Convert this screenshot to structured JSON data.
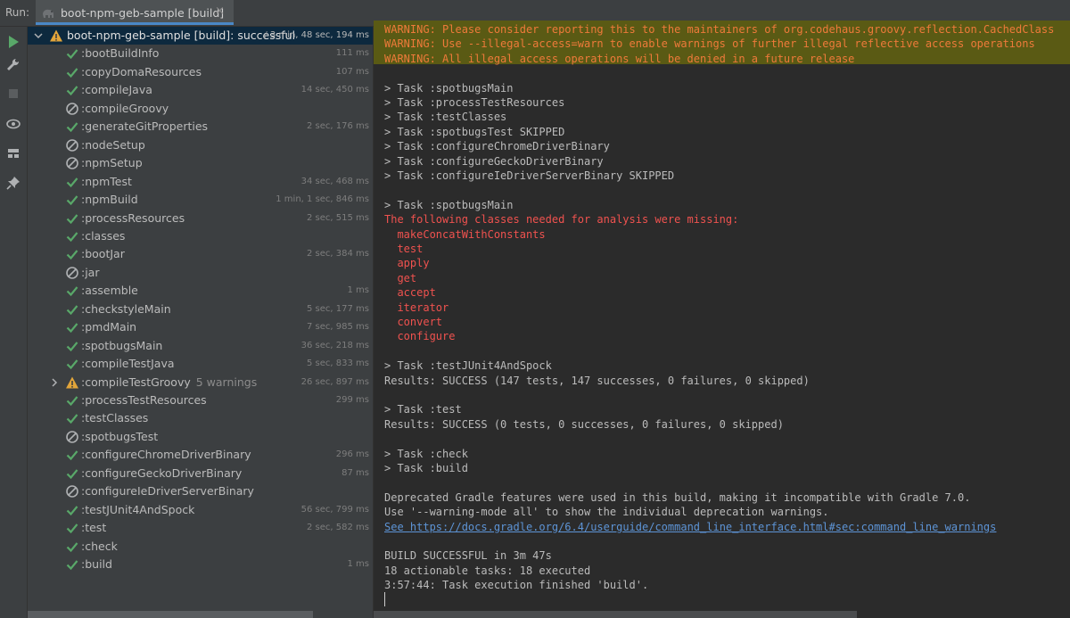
{
  "window": {
    "run_label": "Run:"
  },
  "tab": {
    "title": "boot-npm-geb-sample [build]",
    "close_glyph": "×"
  },
  "colors": {
    "success": "#59a869",
    "warning": "#e2a53a",
    "skipped": "#afb1b3",
    "accent": "#4a88c7"
  },
  "tree": {
    "root": {
      "name": "boot-npm-geb-sample [build]:",
      "status_text": "successful",
      "time": "3 min, 48 sec, 194 ms"
    },
    "tasks": [
      {
        "name": ":bootBuildInfo",
        "status": "success",
        "time": "111 ms"
      },
      {
        "name": ":copyDomaResources",
        "status": "success",
        "time": "107 ms"
      },
      {
        "name": ":compileJava",
        "status": "success",
        "time": "14 sec, 450 ms"
      },
      {
        "name": ":compileGroovy",
        "status": "skipped",
        "time": ""
      },
      {
        "name": ":generateGitProperties",
        "status": "success",
        "time": "2 sec, 176 ms"
      },
      {
        "name": ":nodeSetup",
        "status": "skipped",
        "time": ""
      },
      {
        "name": ":npmSetup",
        "status": "skipped",
        "time": ""
      },
      {
        "name": ":npmTest",
        "status": "success",
        "time": "34 sec, 468 ms"
      },
      {
        "name": ":npmBuild",
        "status": "success",
        "time": "1 min, 1 sec, 846 ms"
      },
      {
        "name": ":processResources",
        "status": "success",
        "time": "2 sec, 515 ms"
      },
      {
        "name": ":classes",
        "status": "success",
        "time": ""
      },
      {
        "name": ":bootJar",
        "status": "success",
        "time": "2 sec, 384 ms"
      },
      {
        "name": ":jar",
        "status": "skipped",
        "time": ""
      },
      {
        "name": ":assemble",
        "status": "success",
        "time": "1 ms"
      },
      {
        "name": ":checkstyleMain",
        "status": "success",
        "time": "5 sec, 177 ms"
      },
      {
        "name": ":pmdMain",
        "status": "success",
        "time": "7 sec, 985 ms"
      },
      {
        "name": ":spotbugsMain",
        "status": "success",
        "time": "36 sec, 218 ms"
      },
      {
        "name": ":compileTestJava",
        "status": "success",
        "time": "5 sec, 833 ms"
      },
      {
        "name": ":compileTestGroovy",
        "status": "warning",
        "warnings": "5 warnings",
        "time": "26 sec, 897 ms",
        "expandable": true
      },
      {
        "name": ":processTestResources",
        "status": "success",
        "time": "299 ms"
      },
      {
        "name": ":testClasses",
        "status": "success",
        "time": ""
      },
      {
        "name": ":spotbugsTest",
        "status": "skipped",
        "time": ""
      },
      {
        "name": ":configureChromeDriverBinary",
        "status": "success",
        "time": "296 ms"
      },
      {
        "name": ":configureGeckoDriverBinary",
        "status": "success",
        "time": "87 ms"
      },
      {
        "name": ":configureIeDriverServerBinary",
        "status": "skipped",
        "time": ""
      },
      {
        "name": ":testJUnit4AndSpock",
        "status": "success",
        "time": "56 sec, 799 ms"
      },
      {
        "name": ":test",
        "status": "success",
        "time": "2 sec, 582 ms"
      },
      {
        "name": ":check",
        "status": "success",
        "time": ""
      },
      {
        "name": ":build",
        "status": "success",
        "time": "1 ms"
      }
    ]
  },
  "console": {
    "lines": [
      {
        "type": "warn",
        "text": "WARNING: Please consider reporting this to the maintainers of org.codehaus.groovy.reflection.CachedClass"
      },
      {
        "type": "warn",
        "text": "WARNING: Use --illegal-access=warn to enable warnings of further illegal reflective access operations"
      },
      {
        "type": "warn",
        "text": "WARNING: All illegal access operations will be denied in a future release"
      },
      {
        "type": "blank",
        "text": ""
      },
      {
        "type": "task",
        "text": "> Task :spotbugsMain"
      },
      {
        "type": "task",
        "text": "> Task :processTestResources"
      },
      {
        "type": "task",
        "text": "> Task :testClasses"
      },
      {
        "type": "task",
        "text": "> Task :spotbugsTest SKIPPED"
      },
      {
        "type": "task",
        "text": "> Task :configureChromeDriverBinary"
      },
      {
        "type": "task",
        "text": "> Task :configureGeckoDriverBinary"
      },
      {
        "type": "task",
        "text": "> Task :configureIeDriverServerBinary SKIPPED"
      },
      {
        "type": "blank",
        "text": ""
      },
      {
        "type": "task",
        "text": "> Task :spotbugsMain"
      },
      {
        "type": "err",
        "text": "The following classes needed for analysis were missing:"
      },
      {
        "type": "err",
        "text": "  makeConcatWithConstants"
      },
      {
        "type": "err",
        "text": "  test"
      },
      {
        "type": "err",
        "text": "  apply"
      },
      {
        "type": "err",
        "text": "  get"
      },
      {
        "type": "err",
        "text": "  accept"
      },
      {
        "type": "err",
        "text": "  iterator"
      },
      {
        "type": "err",
        "text": "  convert"
      },
      {
        "type": "err",
        "text": "  configure"
      },
      {
        "type": "blank",
        "text": ""
      },
      {
        "type": "task",
        "text": "> Task :testJUnit4AndSpock"
      },
      {
        "type": "plain",
        "text": "Results: SUCCESS (147 tests, 147 successes, 0 failures, 0 skipped)"
      },
      {
        "type": "blank",
        "text": ""
      },
      {
        "type": "task",
        "text": "> Task :test"
      },
      {
        "type": "plain",
        "text": "Results: SUCCESS (0 tests, 0 successes, 0 failures, 0 skipped)"
      },
      {
        "type": "blank",
        "text": ""
      },
      {
        "type": "task",
        "text": "> Task :check"
      },
      {
        "type": "task",
        "text": "> Task :build"
      },
      {
        "type": "blank",
        "text": ""
      },
      {
        "type": "plain",
        "text": "Deprecated Gradle features were used in this build, making it incompatible with Gradle 7.0."
      },
      {
        "type": "plain",
        "text": "Use '--warning-mode all' to show the individual deprecation warnings."
      },
      {
        "type": "link",
        "prefix": "See ",
        "text": "https://docs.gradle.org/6.4/userguide/command_line_interface.html#sec:command_line_warnings"
      },
      {
        "type": "blank",
        "text": ""
      },
      {
        "type": "plain",
        "text": "BUILD SUCCESSFUL in 3m 47s"
      },
      {
        "type": "plain",
        "text": "18 actionable tasks: 18 executed"
      },
      {
        "type": "plain",
        "text": "3:57:44: Task execution finished 'build'."
      }
    ]
  },
  "toolbar": {
    "buttons": [
      {
        "icon": "rerun-icon"
      },
      {
        "icon": "wrench-icon"
      },
      {
        "icon": "stop-icon"
      },
      {
        "icon": "eye-icon"
      },
      {
        "icon": "layout-icon"
      },
      {
        "icon": "pin-icon"
      }
    ]
  }
}
